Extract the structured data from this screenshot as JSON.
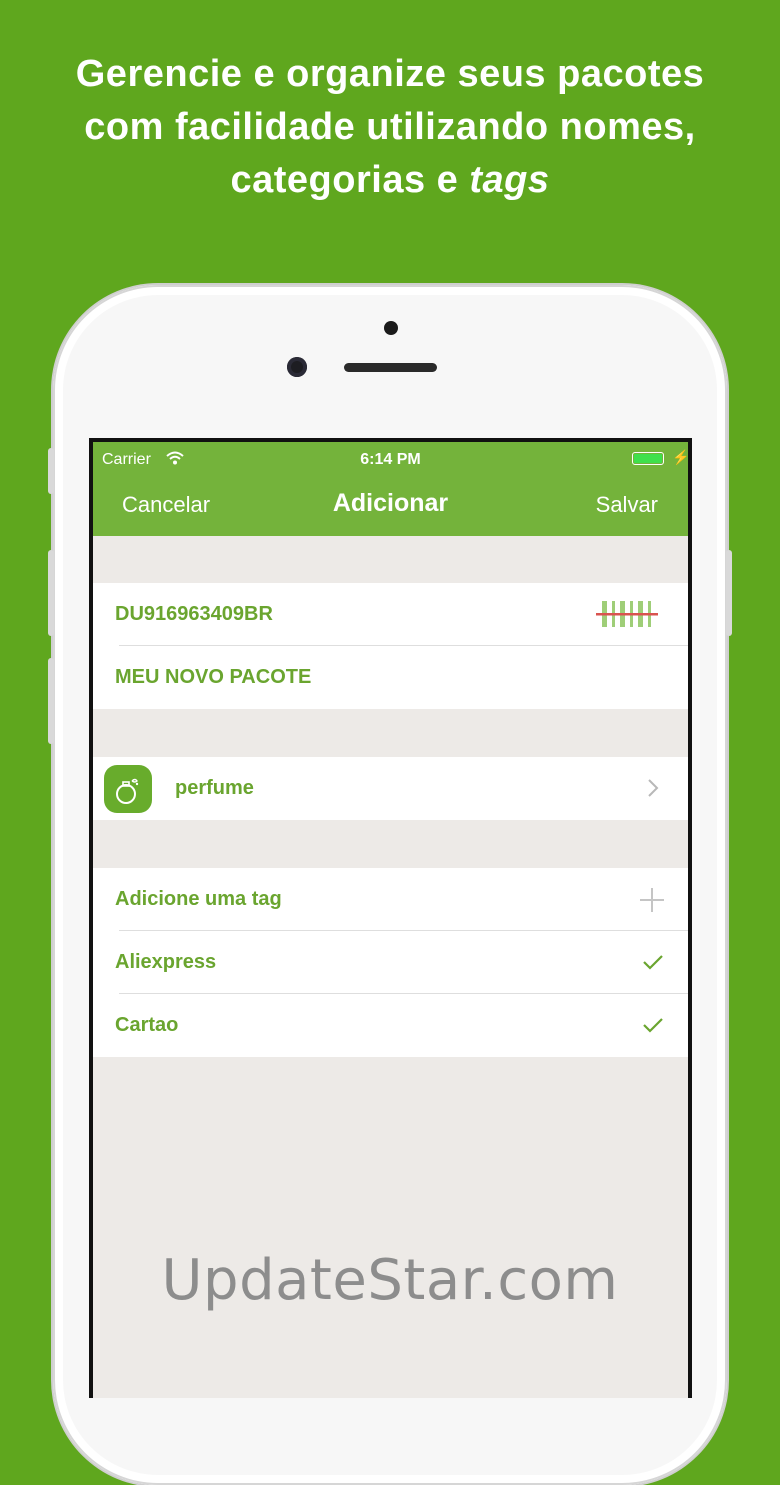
{
  "headline": {
    "line1": "Gerencie e organize seus pacotes",
    "line2": "com facilidade utilizando nomes,",
    "line3_plain": "categorias e ",
    "line3_italic": "tags"
  },
  "status_bar": {
    "carrier": "Carrier",
    "time": "6:14 PM",
    "battery_color": "#3fe04c"
  },
  "nav": {
    "cancel": "Cancelar",
    "title": "Adicionar",
    "save": "Salvar"
  },
  "package": {
    "code": "DU916963409BR",
    "name": "MEU NOVO PACOTE",
    "scan_icon": "barcode-icon"
  },
  "category": {
    "label": "perfume",
    "icon": "perfume-icon"
  },
  "tags": {
    "add_label": "Adicione uma tag",
    "items": [
      {
        "label": "Aliexpress",
        "checked": true
      },
      {
        "label": "Cartao",
        "checked": true
      }
    ]
  },
  "colors": {
    "background": "#5fa71e",
    "nav": "#74b33b",
    "accent_text": "#6aa52f"
  },
  "watermark": "UpdateStar.com"
}
